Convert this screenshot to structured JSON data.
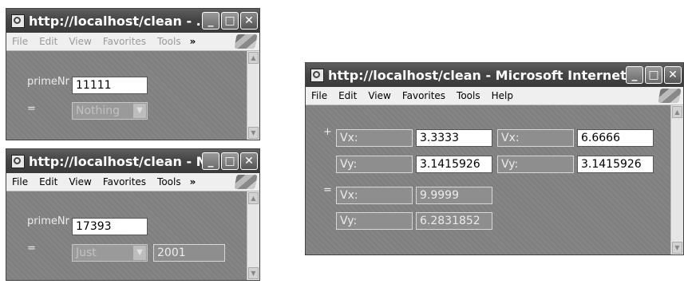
{
  "window1": {
    "title": "http://localhost/clean - ...",
    "menu": [
      "File",
      "Edit",
      "View",
      "Favorites",
      "Tools"
    ],
    "more": "»",
    "prime_label": "primeNr",
    "prime_value": "11111",
    "result_label": "=",
    "result_option": "Nothing"
  },
  "window2": {
    "title": "http://localhost/clean - M...",
    "menu": [
      "File",
      "Edit",
      "View",
      "Favorites",
      "Tools"
    ],
    "more": "»",
    "prime_label": "primeNr",
    "prime_value": "17393",
    "result_label": "=",
    "result_option": "Just",
    "result_value": "2001"
  },
  "window3": {
    "title": "http://localhost/clean - Microsoft Internet Explo...",
    "menu": [
      "File",
      "Edit",
      "View",
      "Favorites",
      "Tools",
      "Help"
    ],
    "plus": "+",
    "equals": "=",
    "vx": "Vx:",
    "vy": "Vy:",
    "vec1": {
      "vx": "3.3333",
      "vy": "3.1415926"
    },
    "vec2": {
      "vx": "6.6666",
      "vy": "3.1415926"
    },
    "result": {
      "vx": "9.9999",
      "vy": "6.2831852"
    }
  },
  "controls": {
    "minimize": "_",
    "maximize": "□",
    "close": "✕"
  },
  "scroll_up": "▲",
  "scroll_down": "▼"
}
